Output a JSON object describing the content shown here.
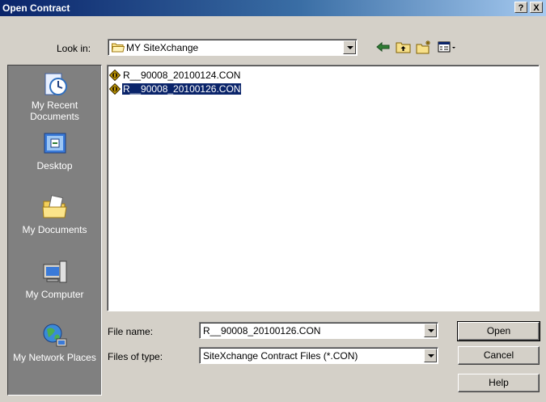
{
  "window": {
    "title": "Open Contract",
    "help_btn": "?",
    "close_btn": "X"
  },
  "look_in": {
    "label": "Look in:",
    "value": "MY SiteXchange"
  },
  "places": [
    {
      "label": "My Recent Documents",
      "icon": "recent-documents-icon"
    },
    {
      "label": "Desktop",
      "icon": "desktop-icon"
    },
    {
      "label": "My Documents",
      "icon": "my-documents-icon"
    },
    {
      "label": "My Computer",
      "icon": "my-computer-icon"
    },
    {
      "label": "My Network Places",
      "icon": "network-places-icon"
    }
  ],
  "files": [
    {
      "name": "R__90008_20100124.CON",
      "selected": false
    },
    {
      "name": "R__90008_20100126.CON",
      "selected": true
    }
  ],
  "file_name": {
    "label": "File name:",
    "value": "R__90008_20100126.CON"
  },
  "file_type": {
    "label": "Files of type:",
    "value": "SiteXchange Contract Files (*.CON)"
  },
  "buttons": {
    "open": "Open",
    "cancel": "Cancel",
    "help": "Help"
  }
}
